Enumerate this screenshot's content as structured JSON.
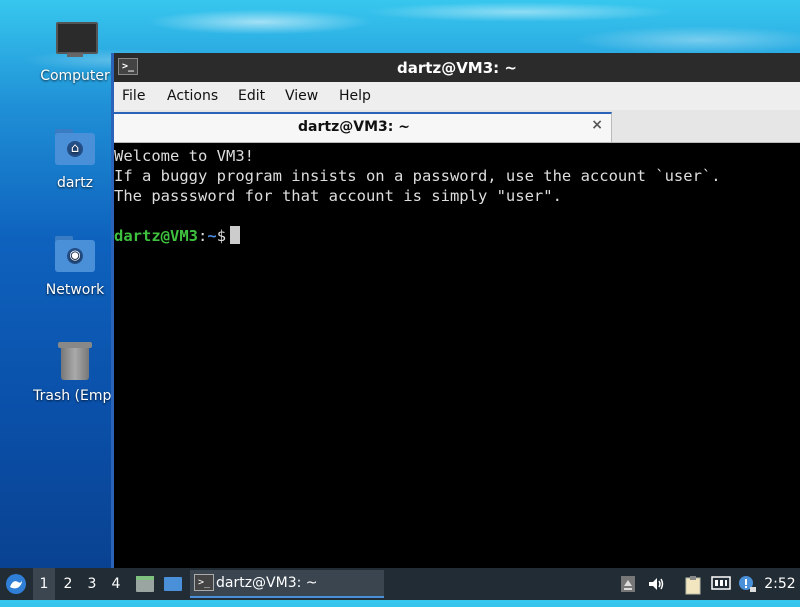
{
  "desktop": {
    "icons": [
      {
        "label": "Computer"
      },
      {
        "label": "dartz"
      },
      {
        "label": "Network"
      },
      {
        "label": "Trash (Empt"
      }
    ]
  },
  "window": {
    "title": "dartz@VM3: ~",
    "menu": [
      "File",
      "Edit",
      "View",
      "Help"
    ],
    "menu_actions": "Actions",
    "tab": {
      "label": "dartz@VM3: ~",
      "close": "×"
    },
    "terminal": {
      "lines": [
        "Welcome to VM3!",
        "If a buggy program insists on a password, use the account `user`.",
        "The passsword for that account is simply \"user\"."
      ],
      "prompt_user": "dartz@VM3",
      "prompt_sep": ":",
      "prompt_path": "~",
      "prompt_symbol": "$"
    }
  },
  "taskbar": {
    "workspaces": [
      "1",
      "2",
      "3",
      "4"
    ],
    "active_workspace": "1",
    "task_label": "dartz@VM3: ~",
    "clock": "2:52"
  },
  "colors": {
    "accent": "#4a90d9",
    "prompt_user": "#3ec13e",
    "prompt_path": "#4b8be0",
    "taskbar_bg": "#222c34"
  }
}
